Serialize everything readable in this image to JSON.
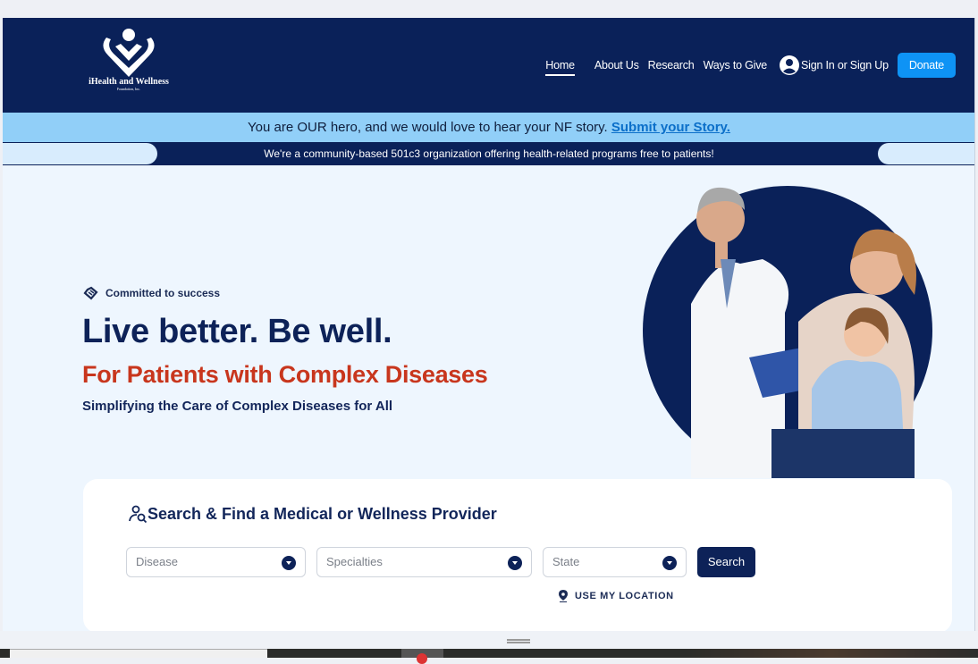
{
  "header": {
    "logo_name": "iHealth and Wellness",
    "logo_sub": "Foundation, Inc.",
    "nav": [
      "Home",
      "About Us",
      "Research",
      "Ways to Give"
    ],
    "signin_label": "Sign In or Sign Up",
    "donate_label": "Donate"
  },
  "banner": {
    "text": "You are OUR hero, and we would love to hear your NF story. ",
    "link": "Submit your Story."
  },
  "ticker": {
    "text": "We're a community-based 501c3 organization offering health-related programs free to patients!"
  },
  "hero": {
    "tag": "Committed to success",
    "title": "Live better. Be well.",
    "subtitle": "For Patients with Complex Diseases",
    "tagline": "Simplifying the Care of Complex Diseases for All"
  },
  "search": {
    "title": "Search & Find a Medical or Wellness Provider",
    "disease_placeholder": "Disease",
    "specialties_placeholder": "Specialties",
    "state_placeholder": "State",
    "button": "Search",
    "location": "USE MY LOCATION"
  },
  "colors": {
    "navy": "#0a2159",
    "accent": "#0e93f5",
    "red": "#c8361d"
  }
}
